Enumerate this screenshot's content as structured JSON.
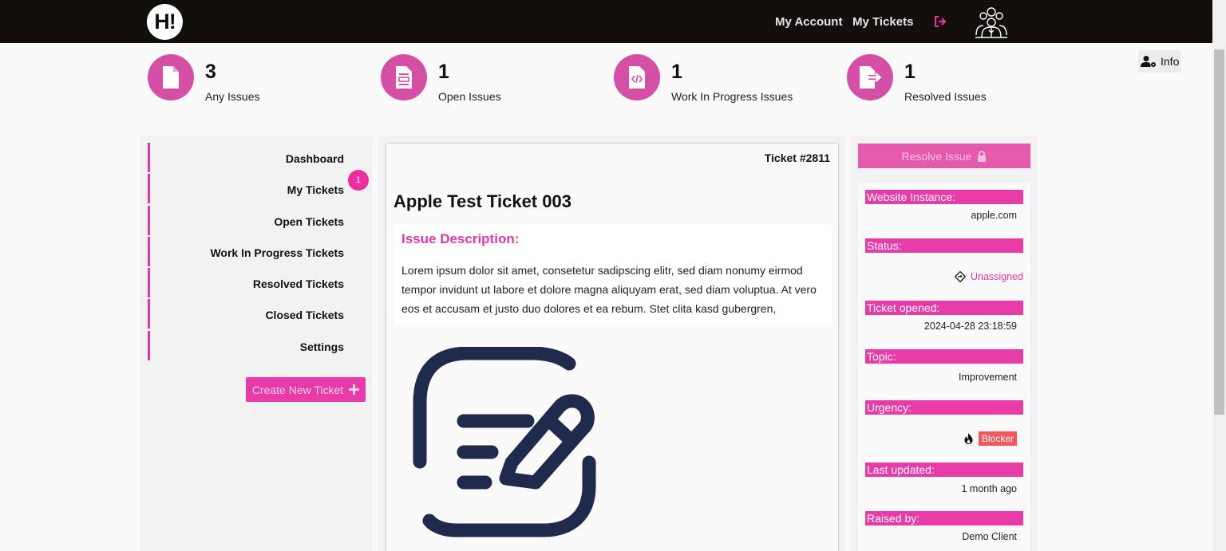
{
  "nav": {
    "logo": "H!",
    "my_account": "My Account",
    "my_tickets": "My Tickets"
  },
  "stats": [
    {
      "count": "3",
      "label": "Any Issues"
    },
    {
      "count": "1",
      "label": "Open Issues"
    },
    {
      "count": "1",
      "label": "Work In Progress Issues"
    },
    {
      "count": "1",
      "label": "Resolved Issues"
    }
  ],
  "info_button": "Info",
  "sidebar": {
    "items": [
      {
        "label": "Dashboard"
      },
      {
        "label": "My Tickets"
      },
      {
        "label": "Open Tickets"
      },
      {
        "label": "Work In Progress Tickets"
      },
      {
        "label": "Resolved Tickets"
      },
      {
        "label": "Closed Tickets"
      },
      {
        "label": "Settings"
      }
    ],
    "my_tickets_badge": "1",
    "create_button": "Create New Ticket"
  },
  "ticket": {
    "number": "Ticket #2811",
    "title": "Apple Test Ticket 003",
    "description_title": "Issue Description:",
    "description": "Lorem ipsum dolor sit amet, consetetur sadipscing elitr, sed diam nonumy eirmod tempor invidunt ut labore et dolore magna aliquyam erat, sed diam voluptua. At vero eos et accusam et justo duo dolores et ea rebum. Stet clita kasd gubergren,"
  },
  "details": {
    "resolve_button": "Resolve Issue",
    "website_label": "Website Instance:",
    "website_value": "apple.com",
    "status_label": "Status:",
    "status_value": "Unassigned",
    "opened_label": "Ticket opened:",
    "opened_value": "2024-04-28 23:18:59",
    "topic_label": "Topic:",
    "topic_value": "Improvement",
    "urgency_label": "Urgency:",
    "urgency_value": "Blocker",
    "updated_label": "Last updated:",
    "updated_value": "1 month ago",
    "raised_label": "Raised by:",
    "raised_value": "Demo Client"
  },
  "colors": {
    "accent": "#e73ba8",
    "topbar": "#120f0b",
    "stat_circle": "#d64fa6",
    "blocker": "#f1595b",
    "illustration": "#1f2a4d"
  }
}
